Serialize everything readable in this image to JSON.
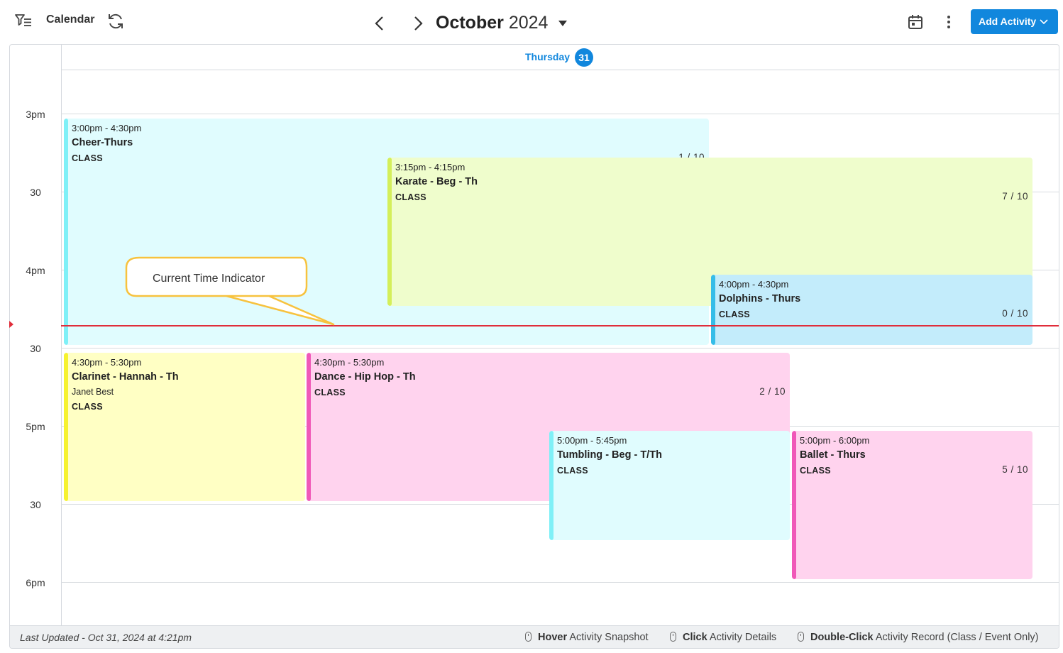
{
  "toolbar": {
    "title": "Calendar",
    "month": "October",
    "year": "2024",
    "add_button": "Add Activity",
    "icons": [
      "filter-icon",
      "refresh-icon",
      "chevron-left-icon",
      "chevron-right-icon",
      "caret-down-icon",
      "calendar-icon",
      "more-vert-icon",
      "chevron-down-icon"
    ]
  },
  "day": {
    "name": "Thursday",
    "number": "31"
  },
  "time_labels": [
    "3pm",
    "30",
    "4pm",
    "30",
    "5pm",
    "30",
    "6pm"
  ],
  "events": [
    {
      "time": "3:00pm - 4:30pm",
      "name": "Cheer-Thurs",
      "type": "CLASS",
      "capacity": "1 / 10",
      "color": "#e0fcfe",
      "bar": "#7ff0f7"
    },
    {
      "time": "3:15pm - 4:15pm",
      "name": "Karate - Beg - Th",
      "type": "CLASS",
      "capacity": "7 / 10",
      "color": "#effdcc",
      "bar": "#d4ef5a"
    },
    {
      "time": "4:00pm - 4:30pm",
      "name": "Dolphins - Thurs",
      "type": "CLASS",
      "capacity": "0 / 10",
      "color": "#c3ecfb",
      "bar": "#36bde8"
    },
    {
      "time": "4:30pm - 5:30pm",
      "name": "Clarinet - Hannah - Th",
      "instructor": "Janet Best",
      "type": "CLASS",
      "color": "#ffffc4",
      "bar": "#f6f230"
    },
    {
      "time": "4:30pm - 5:30pm",
      "name": "Dance - Hip Hop - Th",
      "type": "CLASS",
      "capacity": "2 / 10",
      "color": "#ffd3ee",
      "bar": "#f058b8"
    },
    {
      "time": "5:00pm - 5:45pm",
      "name": "Tumbling - Beg - T/Th",
      "type": "CLASS",
      "color": "#e0fcfe",
      "bar": "#7ff0f7"
    },
    {
      "time": "5:00pm - 6:00pm",
      "name": "Ballet - Thurs",
      "type": "CLASS",
      "capacity": "5 / 10",
      "color": "#ffd3ee",
      "bar": "#f058b8"
    }
  ],
  "callout": {
    "text": "Current Time Indicator"
  },
  "footer": {
    "last_updated": "Last Updated - Oct 31, 2024 at 4:21pm",
    "hints": [
      {
        "action": "Hover",
        "desc": "Activity Snapshot"
      },
      {
        "action": "Click",
        "desc": "Activity Details"
      },
      {
        "action": "Double-Click",
        "desc": "Activity Record (Class / Event Only)"
      }
    ]
  },
  "colors": {
    "accent": "#1187dd",
    "now_line": "#e02d3a",
    "callout_border": "#f7c23e"
  }
}
